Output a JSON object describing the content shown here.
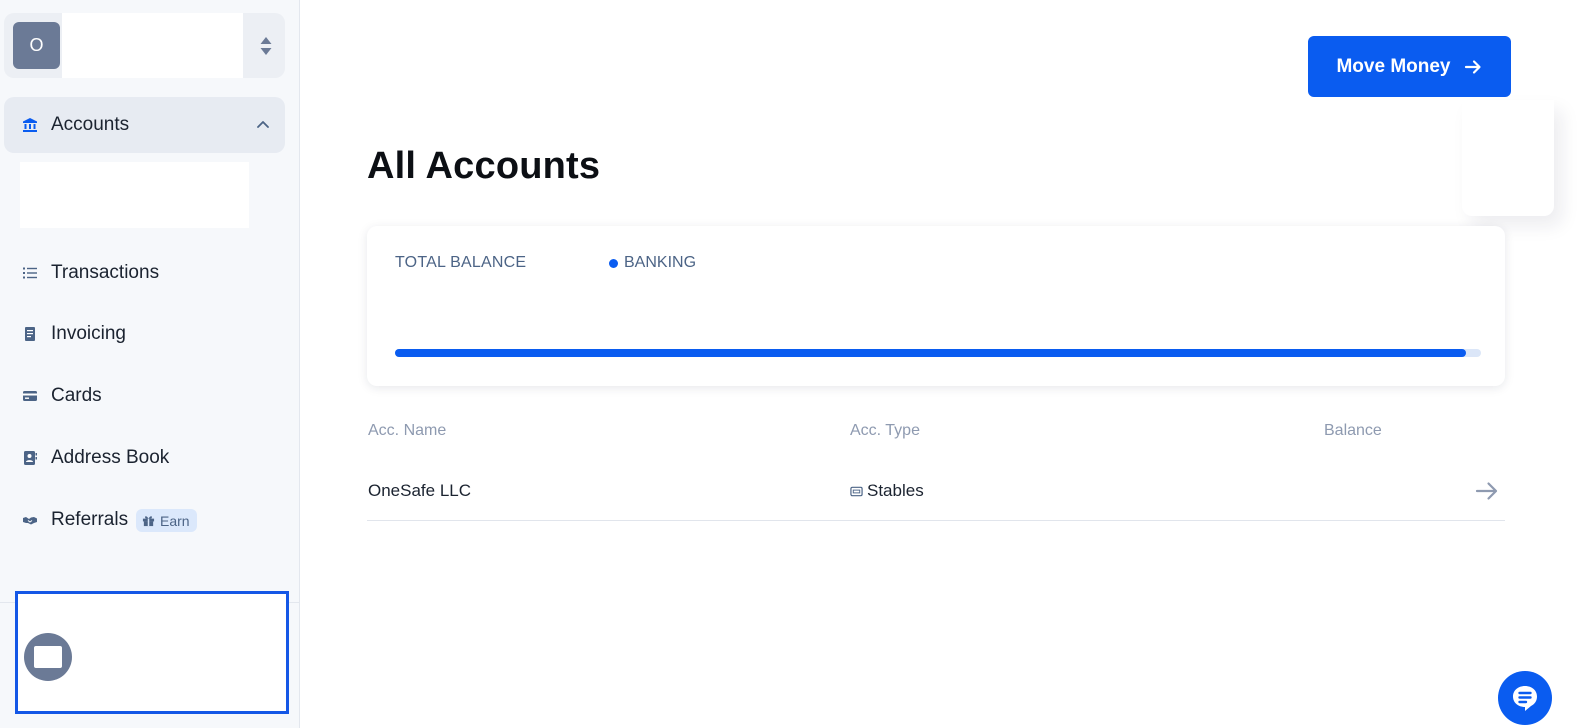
{
  "org": {
    "avatar_initial": "O",
    "name": ""
  },
  "nav": {
    "accounts": "Accounts",
    "transactions": "Transactions",
    "invoicing": "Invoicing",
    "cards": "Cards",
    "address_book": "Address Book",
    "referrals": "Referrals",
    "earn_badge": "Earn"
  },
  "header": {
    "move_money_label": "Move Money"
  },
  "page": {
    "title": "All Accounts"
  },
  "balance": {
    "total_label": "TOTAL BALANCE",
    "legend_label": "BANKING",
    "banking_fraction": 0.986
  },
  "table": {
    "headers": {
      "name": "Acc. Name",
      "type": "Acc. Type",
      "balance": "Balance"
    },
    "rows": [
      {
        "name": "OneSafe LLC",
        "type": "Stables",
        "balance": ""
      }
    ]
  },
  "colors": {
    "accent": "#0a5cf0",
    "muted": "#4c6486",
    "sidebar_bg": "#f6f8fb"
  },
  "icons": {
    "accounts": "bank-icon",
    "transactions": "list-icon",
    "invoicing": "invoice-icon",
    "cards": "card-icon",
    "address_book": "contacts-icon",
    "referrals": "handshake-icon",
    "earn": "gift-icon",
    "move_money": "arrow-right-icon",
    "chat": "chat-icon"
  }
}
